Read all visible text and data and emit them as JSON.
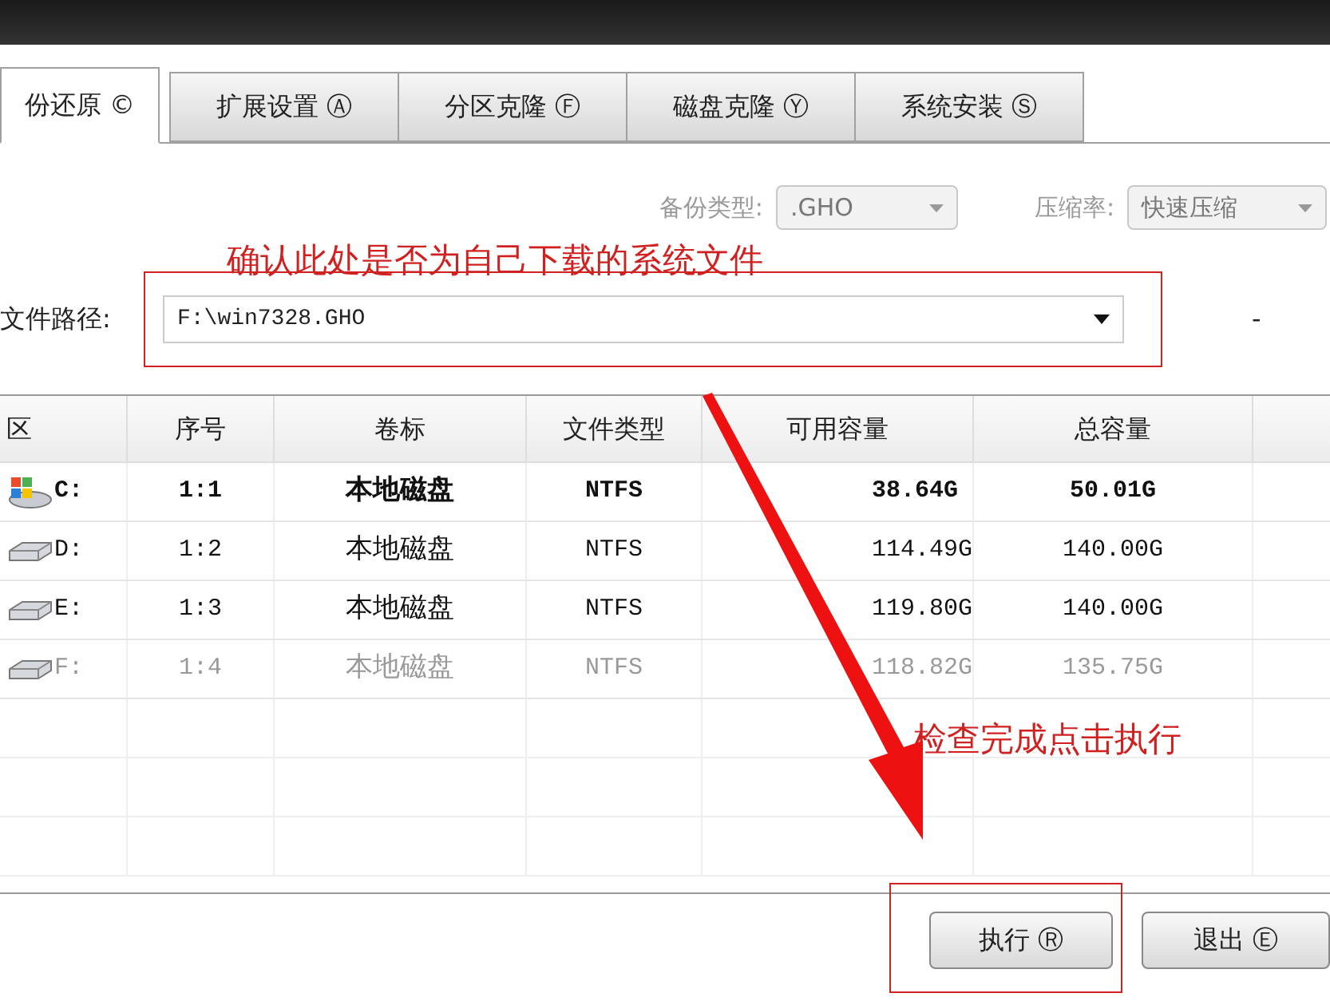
{
  "tabs": [
    {
      "label": "份还原 ©",
      "selected": true
    },
    {
      "label": "扩展设置 Ⓐ",
      "selected": false
    },
    {
      "label": "分区克隆 Ⓕ",
      "selected": false
    },
    {
      "label": "磁盘克隆 Ⓨ",
      "selected": false
    },
    {
      "label": "系统安装 Ⓢ",
      "selected": false
    }
  ],
  "backup_type": {
    "label": "备份类型:",
    "value": ".GHO",
    "disabled": true
  },
  "compression": {
    "label": "压缩率:",
    "value": "快速压缩",
    "disabled": true
  },
  "annotation_top": "确认此处是否为自己下载的系统文件",
  "file_path": {
    "label": "文件路径:",
    "value": "F:\\win7328.GHO"
  },
  "dash": "-",
  "table": {
    "columns": [
      "区",
      "序号",
      "卷标",
      "文件类型",
      "可用容量",
      "总容量"
    ],
    "rows": [
      {
        "kind": "system",
        "disabled": false,
        "cells": [
          "C:",
          "1:1",
          "本地磁盘",
          "NTFS",
          "38.64G",
          "50.01G"
        ]
      },
      {
        "kind": "drive",
        "disabled": false,
        "cells": [
          "D:",
          "1:2",
          "本地磁盘",
          "NTFS",
          "114.49G",
          "140.00G"
        ]
      },
      {
        "kind": "drive",
        "disabled": false,
        "cells": [
          "E:",
          "1:3",
          "本地磁盘",
          "NTFS",
          "119.80G",
          "140.00G"
        ]
      },
      {
        "kind": "drive",
        "disabled": true,
        "cells": [
          "F:",
          "1:4",
          "本地磁盘",
          "NTFS",
          "118.82G",
          "135.75G"
        ]
      }
    ]
  },
  "annotation_bottom": "检查完成点击执行",
  "buttons": [
    "执行 Ⓡ",
    "退出 Ⓔ"
  ]
}
